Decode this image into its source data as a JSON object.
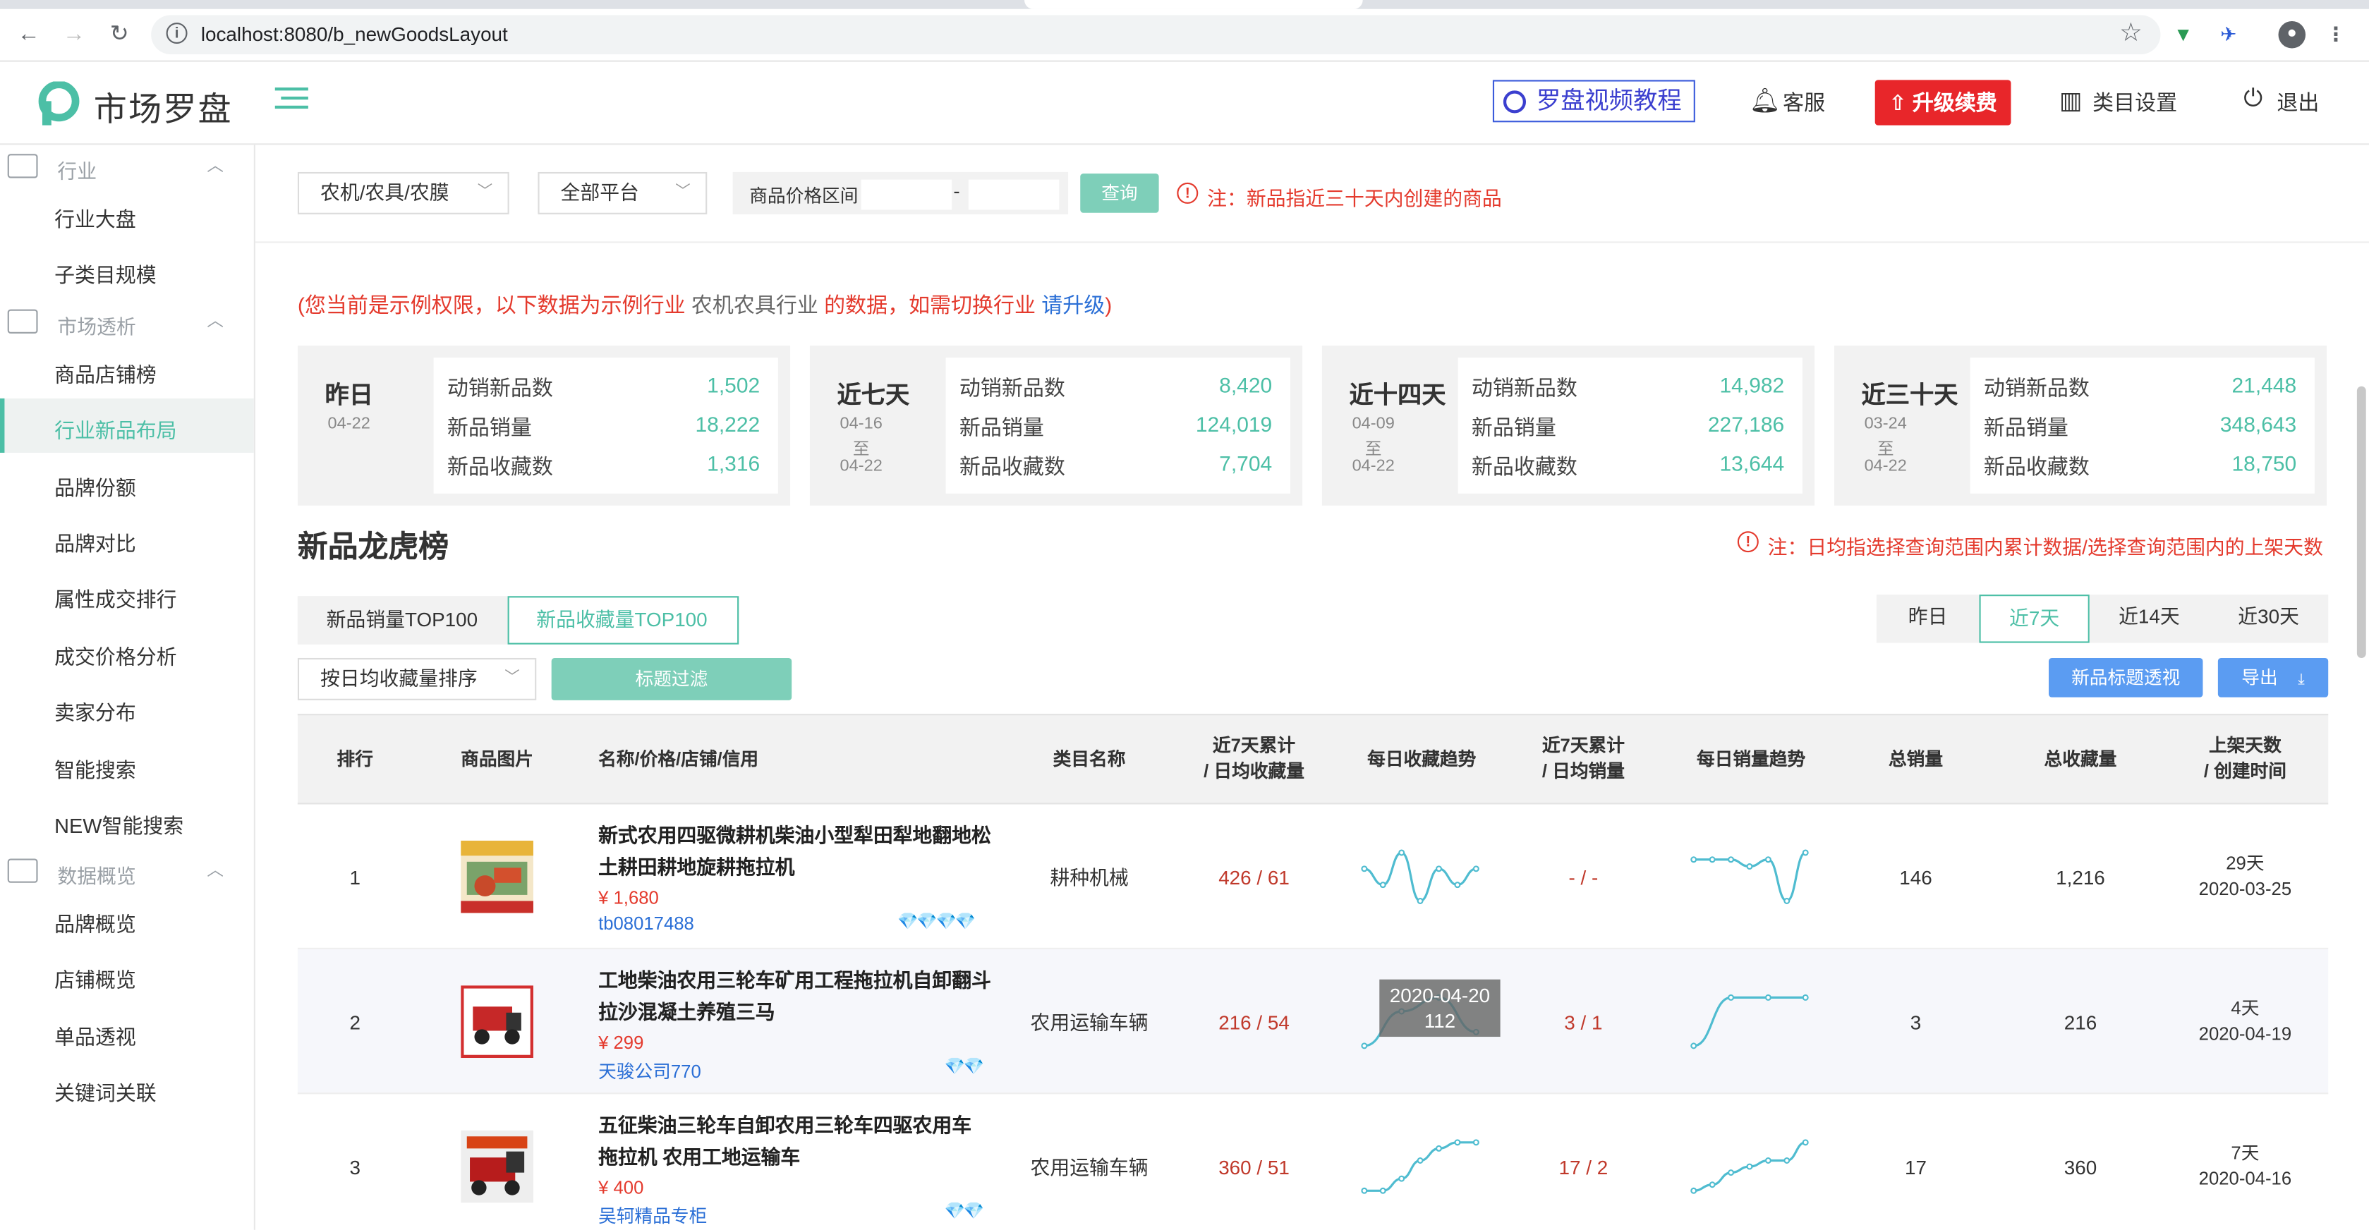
{
  "browser": {
    "url": "localhost:8080/b_newGoodsLayout"
  },
  "header": {
    "logo_text": "市场罗盘",
    "tutorial": "罗盘视频教程",
    "service": "客服",
    "upgrade": "升级续费",
    "category_settings": "类目设置",
    "logout": "退出"
  },
  "sidebar": {
    "groups": [
      {
        "label": "行业",
        "items": [
          "行业大盘",
          "子类目规模"
        ]
      },
      {
        "label": "市场透析",
        "items": [
          "商品店铺榜",
          "行业新品布局",
          "品牌份额",
          "品牌对比",
          "属性成交排行",
          "成交价格分析",
          "卖家分布",
          "智能搜索",
          "NEW智能搜索"
        ]
      },
      {
        "label": "数据概览",
        "items": [
          "品牌概览",
          "店铺概览",
          "单品透视",
          "关键词关联"
        ]
      }
    ],
    "active_item": "行业新品布局"
  },
  "filters": {
    "category": "农机/农具/农膜",
    "platform": "全部平台",
    "price_label": "商品价格区间",
    "price_sep": "-",
    "query_button": "查询",
    "note": "注：新品指近三十天内创建的商品"
  },
  "warning": {
    "part1": "(您当前是示例权限，以下数据为示例行业 ",
    "industry": "农机农具行业",
    "part2": " 的数据，如需切换行业 ",
    "link": "请升级",
    "part3": ")"
  },
  "summary_cards": [
    {
      "title": "昨日",
      "date_from": "04-22",
      "date_sep": "",
      "date_to": "",
      "rows": [
        {
          "k": "动销新品数",
          "v": "1,502"
        },
        {
          "k": "新品销量",
          "v": "18,222"
        },
        {
          "k": "新品收藏数",
          "v": "1,316"
        }
      ]
    },
    {
      "title": "近七天",
      "date_from": "04-16",
      "date_sep": "至",
      "date_to": "04-22",
      "rows": [
        {
          "k": "动销新品数",
          "v": "8,420"
        },
        {
          "k": "新品销量",
          "v": "124,019"
        },
        {
          "k": "新品收藏数",
          "v": "7,704"
        }
      ]
    },
    {
      "title": "近十四天",
      "date_from": "04-09",
      "date_sep": "至",
      "date_to": "04-22",
      "rows": [
        {
          "k": "动销新品数",
          "v": "14,982"
        },
        {
          "k": "新品销量",
          "v": "227,186"
        },
        {
          "k": "新品收藏数",
          "v": "13,644"
        }
      ]
    },
    {
      "title": "近三十天",
      "date_from": "03-24",
      "date_sep": "至",
      "date_to": "04-22",
      "rows": [
        {
          "k": "动销新品数",
          "v": "21,448"
        },
        {
          "k": "新品销量",
          "v": "348,643"
        },
        {
          "k": "新品收藏数",
          "v": "18,750"
        }
      ]
    }
  ],
  "ranking": {
    "title": "新品龙虎榜",
    "note": "注：日均指选择查询范围内累计数据/选择查询范围内的上架天数",
    "tabs": [
      "新品销量TOP100",
      "新品收藏量TOP100"
    ],
    "active_tab": 1,
    "periods": [
      "昨日",
      "近7天",
      "近14天",
      "近30天"
    ],
    "active_period": 1,
    "sort": "按日均收藏量排序",
    "filter_button": "标题过滤",
    "title_perspective": "新品标题透视",
    "export": "导出",
    "columns": [
      "排行",
      "商品图片",
      "名称/价格/店铺/信用",
      "类目名称",
      "近7天累计\n/ 日均收藏量",
      "每日收藏趋势",
      "近7天累计\n/ 日均销量",
      "每日销量趋势",
      "总销量",
      "总收藏量",
      "上架天数\n/ 创建时间"
    ],
    "rows": [
      {
        "rank": "1",
        "name": "新式农用四驱微耕机柴油小型犁田犁地翻地松土耕田耕地旋耕拖拉机",
        "price": "¥ 1,680",
        "shop": "tb08017488",
        "credit": "💎💎💎💎",
        "category": "耕种机械",
        "fav": "426 / 61",
        "sales": "- / -",
        "total_sales": "146",
        "total_fav": "1,216",
        "days": "29天",
        "created": "2020-03-25",
        "fav_trend": [
          6,
          5,
          7,
          4,
          6,
          5,
          6
        ],
        "sales_trend": [
          8,
          8,
          8,
          7,
          8,
          2,
          9
        ]
      },
      {
        "rank": "2",
        "name": "工地柴油农用三轮车矿用工程拖拉机自卸翻斗拉沙混凝土养殖三马",
        "price": "¥ 299",
        "shop": "天骏公司770",
        "credit": "💎💎",
        "category": "农用运输车辆",
        "fav": "216 / 54",
        "sales": "3 / 1",
        "total_sales": "3",
        "total_fav": "216",
        "days": "4天",
        "created": "2020-04-19",
        "fav_trend": [
          1,
          6,
          8,
          3
        ],
        "sales_trend": [
          0,
          1,
          1,
          1
        ],
        "tooltip": {
          "date": "2020-04-20",
          "value": "112"
        }
      },
      {
        "rank": "3",
        "name": "五征柴油三轮车自卸农用三轮车四驱农用车 拖拉机 农用工地运输车",
        "price": "¥ 400",
        "shop": "吴轲精品专柜",
        "credit": "💎💎",
        "category": "农用运输车辆",
        "fav": "360 / 51",
        "sales": "17 / 2",
        "total_sales": "17",
        "total_fav": "360",
        "days": "7天",
        "created": "2020-04-16",
        "fav_trend": [
          1,
          1,
          3,
          6,
          8,
          9,
          9
        ],
        "sales_trend": [
          1,
          2,
          4,
          5,
          6,
          6,
          9
        ]
      }
    ]
  },
  "colors": {
    "accent": "#4cbfa6",
    "red": "#e43a2d",
    "blue": "#5b9cf2",
    "spark": "#4fbcd0"
  }
}
